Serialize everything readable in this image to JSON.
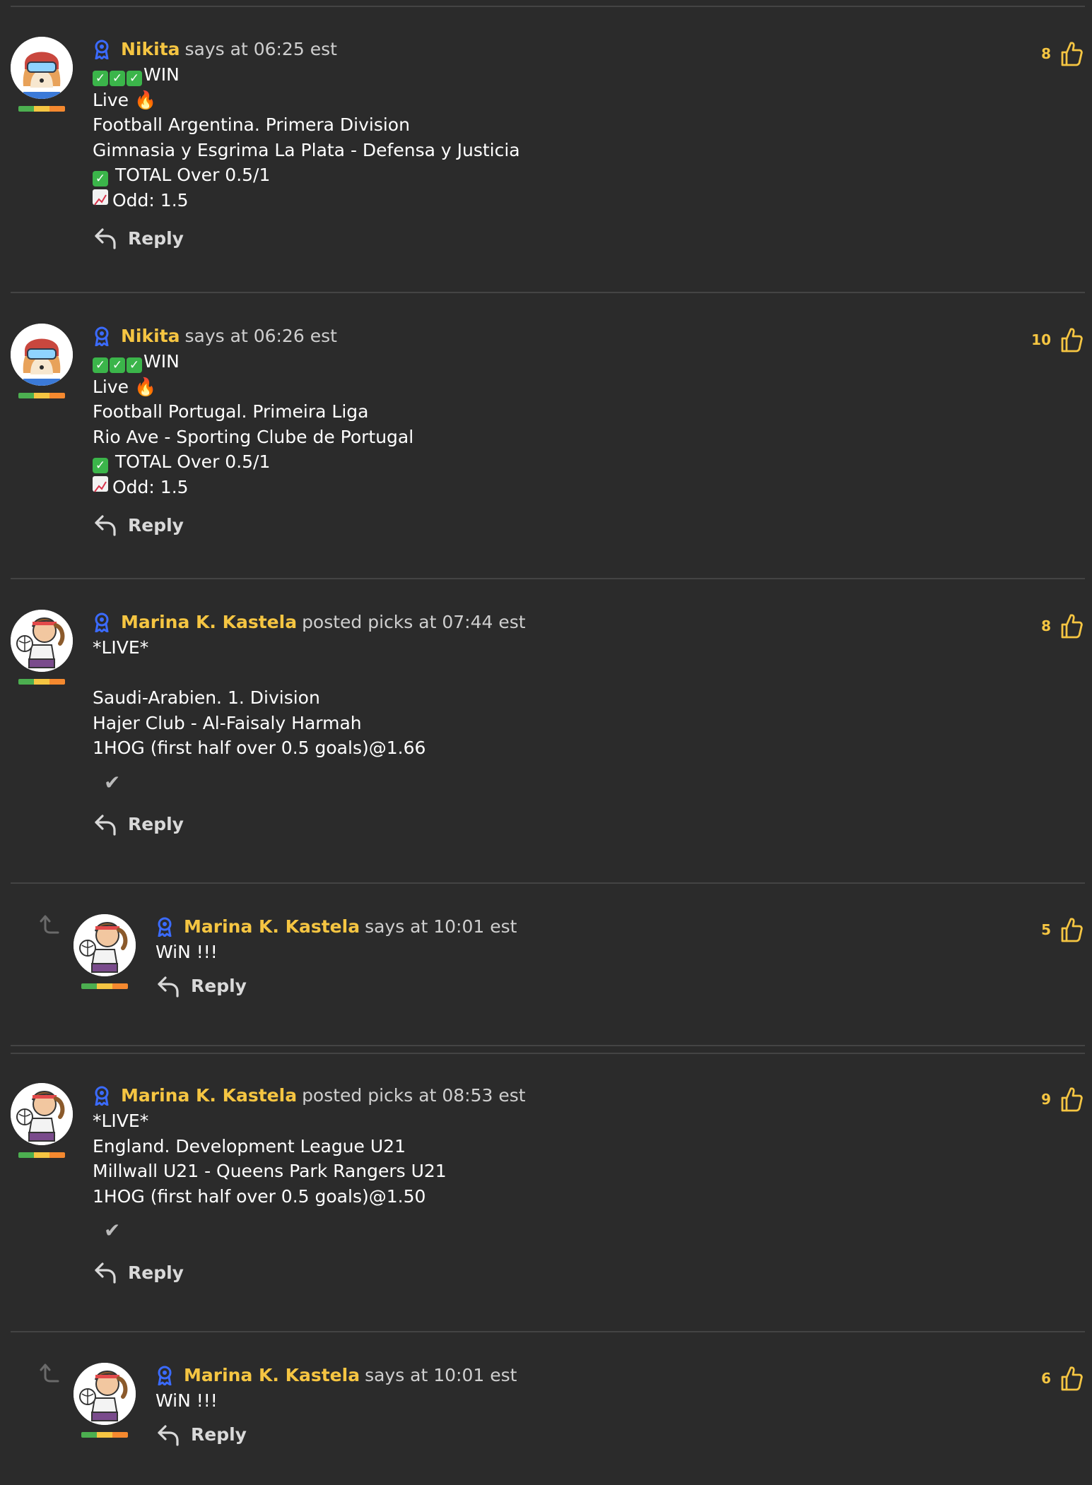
{
  "colors": {
    "background": "#2b2b2b",
    "author": "#f5c542",
    "divider": "#444444"
  },
  "comments": [
    {
      "author": "Nikita",
      "meta": "says at 06:25 est",
      "likes": "8",
      "reply_label": "Reply",
      "avatar": "shiba-helmet-avatar",
      "lines": [
        "WIN",
        "Live 🔥",
        "Football Argentina. Primera Division",
        "Gimnasia y Esgrima La Plata - Defensa y Justicia",
        "TOTAL Over 0.5/1",
        "Odd: 1.5"
      ]
    },
    {
      "author": "Nikita",
      "meta": "says at 06:26 est",
      "likes": "10",
      "reply_label": "Reply",
      "avatar": "shiba-helmet-avatar",
      "lines": [
        "WIN",
        "Live 🔥",
        "Football Portugal. Primeira Liga",
        "Rio Ave - Sporting Clube de Portugal",
        "TOTAL Over 0.5/1",
        "Odd: 1.5"
      ]
    },
    {
      "author": "Marina K. Kastela",
      "meta": "posted picks at 07:44 est",
      "likes": "8",
      "reply_label": "Reply",
      "avatar": "volleyball-player-avatar",
      "lines": [
        "*LIVE*",
        "",
        "Saudi-Arabien. 1. Division",
        "Hajer Club - Al-Faisaly Harmah",
        "1HOG (first half over 0.5 goals)@1.66"
      ]
    },
    {
      "author": "Marina K. Kastela",
      "meta": "says at 10:01 est",
      "likes": "5",
      "reply_label": "Reply",
      "avatar": "volleyball-player-avatar",
      "lines": [
        "WiN !!!"
      ]
    },
    {
      "author": "Marina K. Kastela",
      "meta": "posted picks at 08:53 est",
      "likes": "9",
      "reply_label": "Reply",
      "avatar": "volleyball-player-avatar",
      "lines": [
        "*LIVE*",
        "England. Development League U21",
        "Millwall U21 - Queens Park Rangers U21",
        "1HOG (first half over 0.5 goals)@1.50"
      ]
    },
    {
      "author": "Marina K. Kastela",
      "meta": "says at 10:01 est",
      "likes": "6",
      "reply_label": "Reply",
      "avatar": "volleyball-player-avatar",
      "lines": [
        "WiN !!!"
      ]
    }
  ]
}
